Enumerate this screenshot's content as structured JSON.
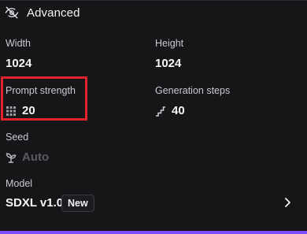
{
  "advanced": {
    "title": "Advanced",
    "icon": "eye-off-icon"
  },
  "fields": {
    "width": {
      "label": "Width",
      "value": "1024"
    },
    "height": {
      "label": "Height",
      "value": "1024"
    },
    "prompt_strength": {
      "label": "Prompt strength",
      "value": "20",
      "icon": "grid-dots-icon"
    },
    "generation_steps": {
      "label": "Generation steps",
      "value": "40",
      "icon": "stairs-icon"
    },
    "seed": {
      "label": "Seed",
      "value": "Auto",
      "icon": "seedling-icon"
    }
  },
  "model": {
    "label": "Model",
    "name": "SDXL v1.0",
    "badge": "New",
    "chevron_icon": "chevron-right-icon"
  },
  "colors": {
    "background": "#161619",
    "highlight": "#e0242c",
    "accent_bar": "#7c4dff"
  }
}
